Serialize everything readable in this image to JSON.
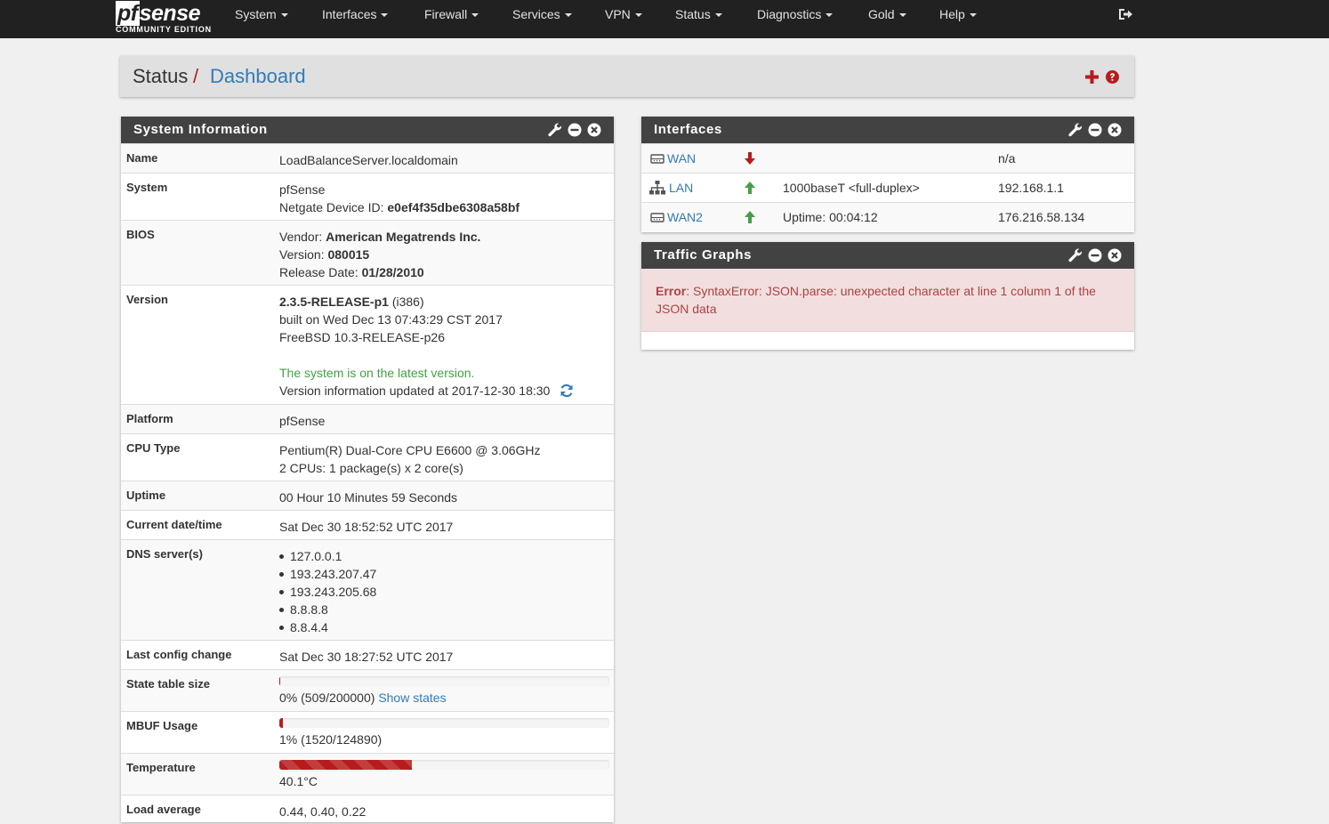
{
  "brand": {
    "logo_pf": "pf",
    "logo_sense": "sense",
    "edition": "COMMUNITY EDITION"
  },
  "nav": {
    "items": [
      "System",
      "Interfaces",
      "Firewall",
      "Services",
      "VPN",
      "Status",
      "Diagnostics",
      "Gold",
      "Help"
    ],
    "logout_icon": "sign-out-icon"
  },
  "breadcrumb": {
    "section": "Status",
    "separator": "/",
    "page": "Dashboard"
  },
  "sysinfo": {
    "title": "System Information",
    "name_label": "Name",
    "name_value": "LoadBalanceServer.localdomain",
    "system_label": "System",
    "system_value": "pfSense",
    "device_id_label": "Netgate Device ID:",
    "device_id": "e0ef4f35dbe6308a58bf",
    "bios_label": "BIOS",
    "bios_vendor_label": "Vendor:",
    "bios_vendor": "American Megatrends Inc.",
    "bios_version_label": "Version:",
    "bios_version": "080015",
    "bios_date_label": "Release Date:",
    "bios_date": "01/28/2010",
    "version_label": "Version",
    "version_release": "2.3.5-RELEASE-p1",
    "version_arch": "(i386)",
    "version_built": "built on Wed Dec 13 07:43:29 CST 2017",
    "version_freebsd": "FreeBSD 10.3-RELEASE-p26",
    "version_status": "The system is on the latest version.",
    "version_updated": "Version information updated at 2017-12-30 18:30",
    "platform_label": "Platform",
    "platform_value": "pfSense",
    "cpu_label": "CPU Type",
    "cpu_model": "Pentium(R) Dual-Core CPU E6600 @ 3.06GHz",
    "cpu_count": "2 CPUs: 1 package(s) x 2 core(s)",
    "uptime_label": "Uptime",
    "uptime_value": "00 Hour 10 Minutes 59 Seconds",
    "datetime_label": "Current date/time",
    "datetime_value": "Sat Dec 30 18:52:52 UTC 2017",
    "dns_label": "DNS server(s)",
    "dns_servers": [
      "127.0.0.1",
      "193.243.207.47",
      "193.243.205.68",
      "8.8.8.8",
      "8.8.4.4"
    ],
    "config_label": "Last config change",
    "config_value": "Sat Dec 30 18:27:52 UTC 2017",
    "state_label": "State table size",
    "state_value": "0% (509/200000)",
    "state_link": "Show states",
    "state_fraction": 0.0025,
    "mbuf_label": "MBUF Usage",
    "mbuf_value": "1% (1520/124890)",
    "mbuf_fraction": 0.012,
    "temp_label": "Temperature",
    "temp_value": "40.1°C",
    "temp_fraction": 0.401,
    "load_label": "Load average",
    "load_value": "0.44, 0.40, 0.22"
  },
  "interfaces": {
    "title": "Interfaces",
    "rows": [
      {
        "icon": "ethernet-icon",
        "name": "WAN",
        "status": "down",
        "media": "",
        "ip": "n/a"
      },
      {
        "icon": "network-tree-icon",
        "name": "LAN",
        "status": "up",
        "media": "1000baseT <full-duplex>",
        "ip": "192.168.1.1"
      },
      {
        "icon": "ethernet-icon",
        "name": "WAN2",
        "status": "up",
        "media": "Uptime: 00:04:12",
        "ip": "176.216.58.134"
      }
    ]
  },
  "traffic": {
    "title": "Traffic Graphs",
    "error_label": "Error",
    "error_text": ": SyntaxError: JSON.parse: unexpected character at line 1 column 1 of the",
    "error_text2": "JSON data"
  },
  "colors": {
    "navbar": "#212121",
    "brand_red": "#b71c1c",
    "link": "#337ab7",
    "up": "#43a047",
    "down": "#b71c1c",
    "panel_heading": "#424242"
  }
}
